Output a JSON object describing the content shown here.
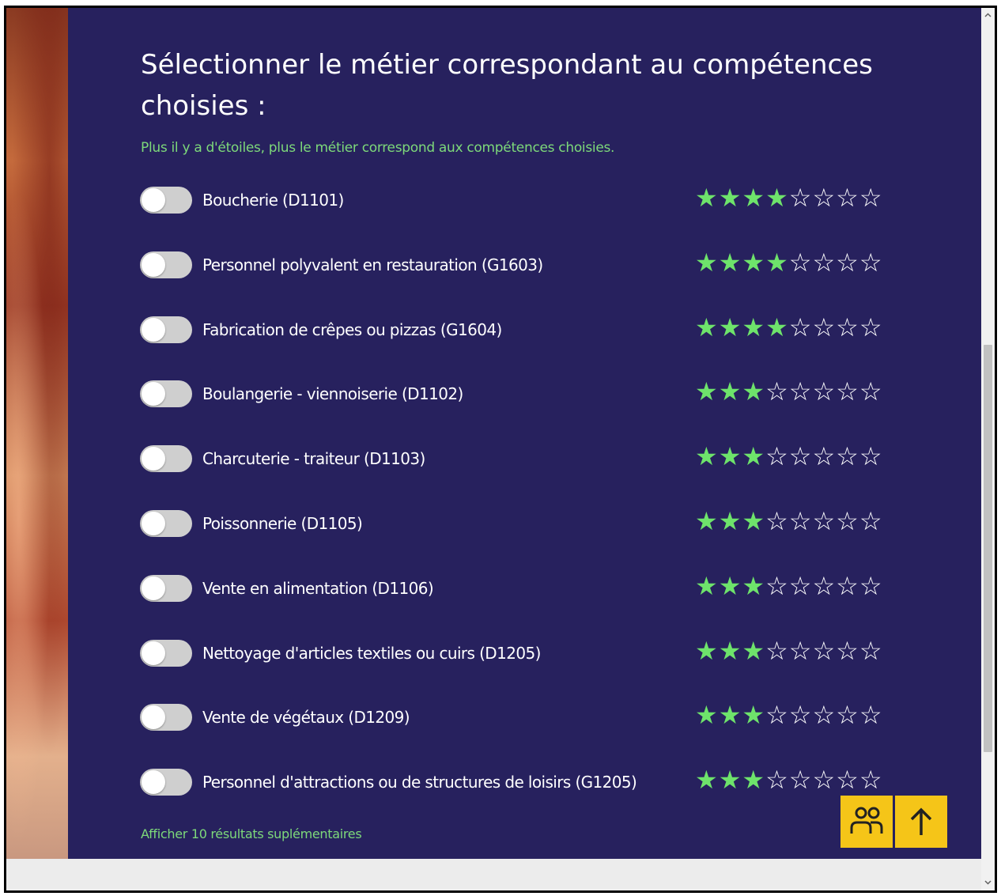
{
  "header": {
    "title": "Sélectionner le métier correspondant au compétences choisies :",
    "subtitle": "Plus il y a d'étoiles, plus le métier correspond aux compétences choisies."
  },
  "jobs": [
    {
      "label": "Boucherie (D1101)",
      "stars": 4,
      "max_stars": 8,
      "selected": false
    },
    {
      "label": "Personnel polyvalent en restauration (G1603)",
      "stars": 4,
      "max_stars": 8,
      "selected": false
    },
    {
      "label": "Fabrication de crêpes ou pizzas (G1604)",
      "stars": 4,
      "max_stars": 8,
      "selected": false
    },
    {
      "label": "Boulangerie - viennoiserie (D1102)",
      "stars": 3,
      "max_stars": 8,
      "selected": false
    },
    {
      "label": "Charcuterie - traiteur (D1103)",
      "stars": 3,
      "max_stars": 8,
      "selected": false
    },
    {
      "label": "Poissonnerie (D1105)",
      "stars": 3,
      "max_stars": 8,
      "selected": false
    },
    {
      "label": "Vente en alimentation (D1106)",
      "stars": 3,
      "max_stars": 8,
      "selected": false
    },
    {
      "label": "Nettoyage d'articles textiles ou cuirs (D1205)",
      "stars": 3,
      "max_stars": 8,
      "selected": false
    },
    {
      "label": "Vente de végétaux (D1209)",
      "stars": 3,
      "max_stars": 8,
      "selected": false
    },
    {
      "label": "Personnel d'attractions ou de structures de loisirs (G1205)",
      "stars": 3,
      "max_stars": 8,
      "selected": false
    }
  ],
  "more_results_label": "Afficher 10 résultats suplémentaires",
  "buttons": {
    "contact_icon": "people-icon",
    "back_to_top_icon": "arrow-up-icon"
  },
  "colors": {
    "panel_background": "#27215e",
    "accent_green": "#6ee36b",
    "button_yellow": "#f5c518",
    "toggle_off": "#cfcfcf"
  }
}
